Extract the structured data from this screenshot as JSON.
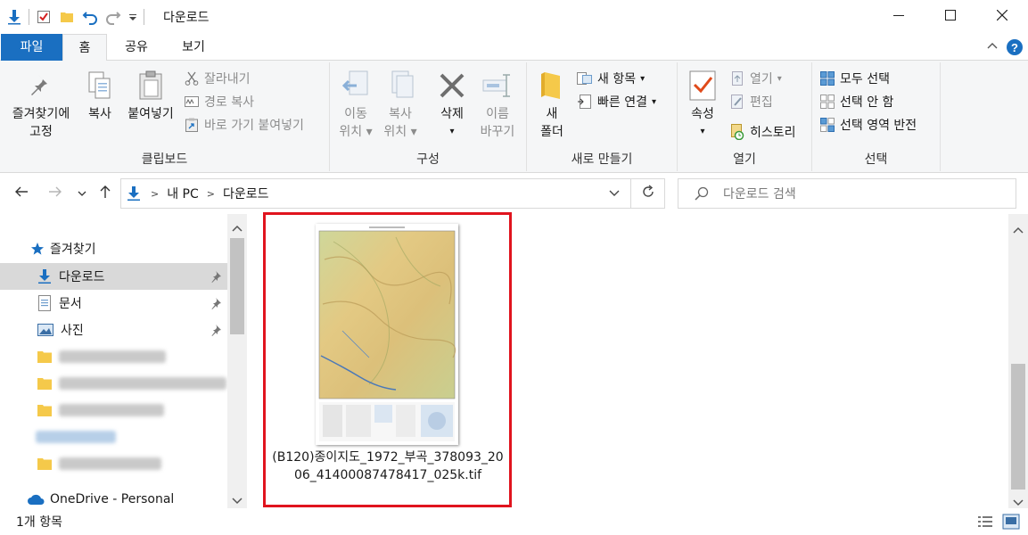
{
  "window": {
    "title": "다운로드",
    "controls": {
      "minimize": "minimize-icon",
      "maximize": "maximize-icon",
      "close": "close-icon"
    }
  },
  "ribbon_tabs": {
    "file": "파일",
    "home": "홈",
    "share": "공유",
    "view": "보기"
  },
  "ribbon": {
    "clipboard": {
      "label": "클립보드",
      "pin_quick_access": [
        "즐겨찾기에",
        "고정"
      ],
      "copy": "복사",
      "paste": "붙여넣기",
      "cut": "잘라내기",
      "copy_path": "경로 복사",
      "paste_shortcut": "바로 가기 붙여넣기"
    },
    "organize": {
      "label": "구성",
      "move_to": [
        "이동",
        "위치"
      ],
      "copy_to": [
        "복사",
        "위치"
      ],
      "delete": "삭제",
      "rename": [
        "이름",
        "바꾸기"
      ]
    },
    "new": {
      "label": "새로 만들기",
      "new_folder": [
        "새",
        "폴더"
      ],
      "new_item": "새 항목",
      "easy_access": "빠른 연결"
    },
    "open": {
      "label": "열기",
      "properties": "속성",
      "open": "열기",
      "edit": "편집",
      "history": "히스토리"
    },
    "select": {
      "label": "선택",
      "select_all": "모두 선택",
      "select_none": "선택 안 함",
      "invert": "선택 영역 반전"
    }
  },
  "address": {
    "segments": [
      "내 PC",
      "다운로드"
    ],
    "search_placeholder": "다운로드 검색"
  },
  "nav": {
    "quick_access": "즐겨찾기",
    "items": [
      "다운로드",
      "문서",
      "사진"
    ],
    "onedrive": "OneDrive - Personal"
  },
  "files": [
    {
      "name": "(B120)종이지도_1972_부곡_378093_2006_41400087478417_025k.tif"
    }
  ],
  "status": {
    "count": "1개 항목"
  },
  "colors": {
    "accent": "#1a6fc1",
    "selection_border": "#e0141e",
    "nav_selected": "#d9d9d9"
  }
}
